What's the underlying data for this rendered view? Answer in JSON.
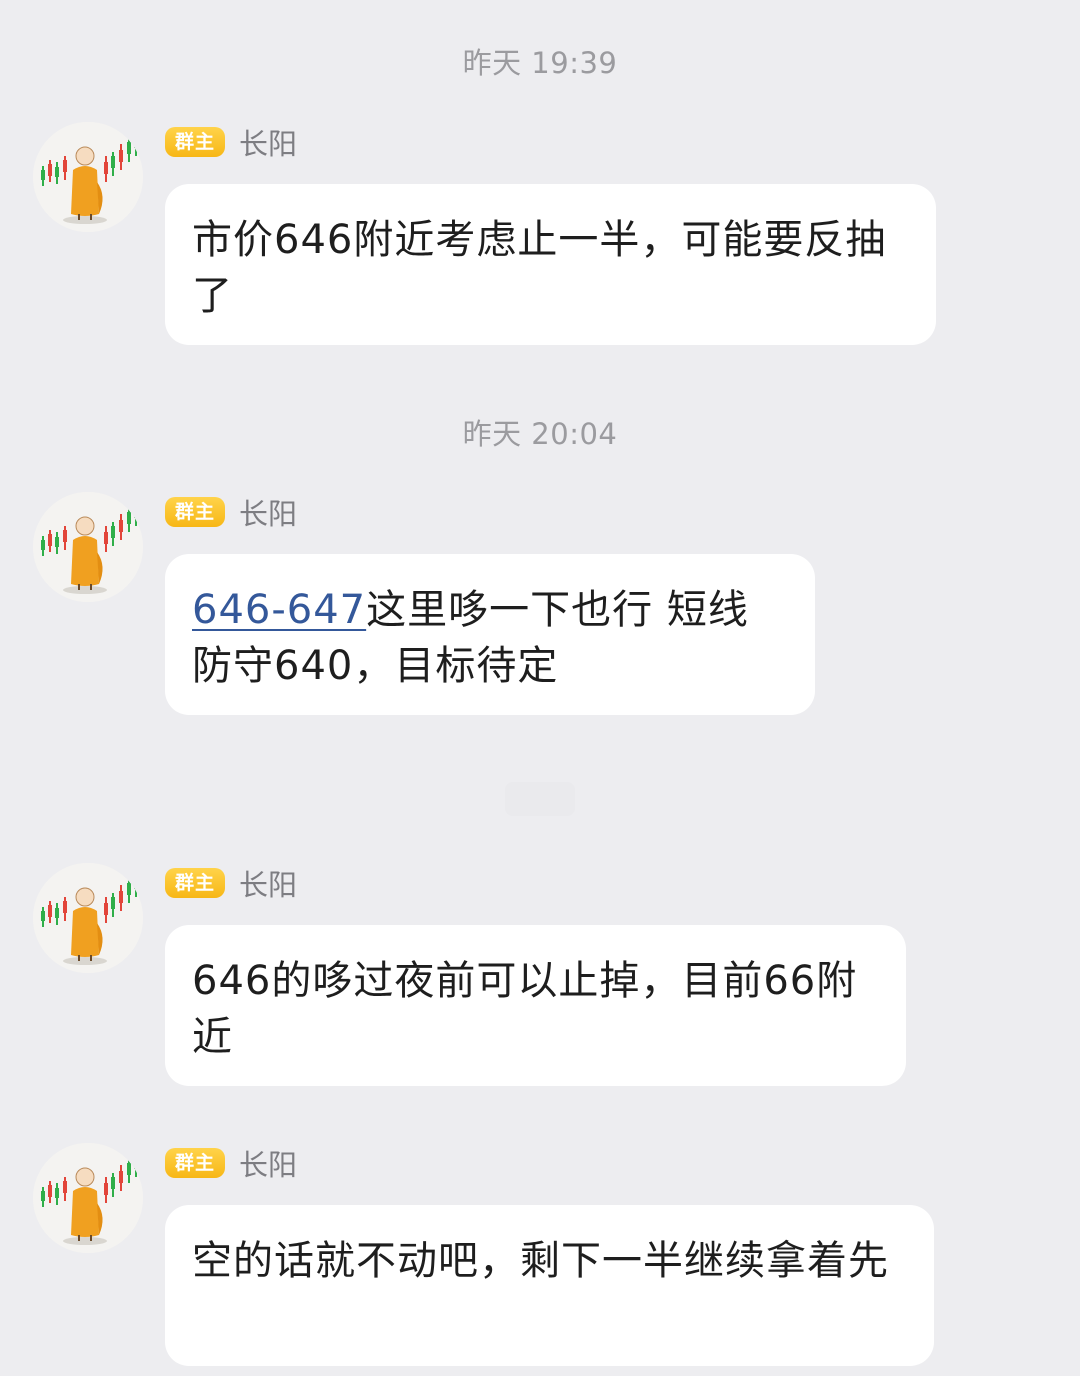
{
  "timestamps": {
    "first": "昨天 19:39",
    "second": "昨天 20:04"
  },
  "messages": [
    {
      "badge": "群主",
      "sender": "长阳",
      "text": "市价646附近考虑止一半，可能要反抽了"
    },
    {
      "badge": "群主",
      "sender": "长阳",
      "link": "646-647",
      "text": "这里哆一下也行 短线防守640，目标待定"
    },
    {
      "badge": "群主",
      "sender": "长阳",
      "text": "646的哆过夜前可以止掉，目前66附近"
    },
    {
      "badge": "群主",
      "sender": "长阳",
      "text": "空的话就不动吧，剩下一半继续拿着先"
    }
  ],
  "colors": {
    "background": "#ededf0",
    "bubble": "#ffffff",
    "badge": "#f7b716",
    "link": "#34589a",
    "avatar_figure": "#f0a020"
  },
  "icons": {
    "avatar": "orange-robed-monk-with-candlestick-chart"
  }
}
